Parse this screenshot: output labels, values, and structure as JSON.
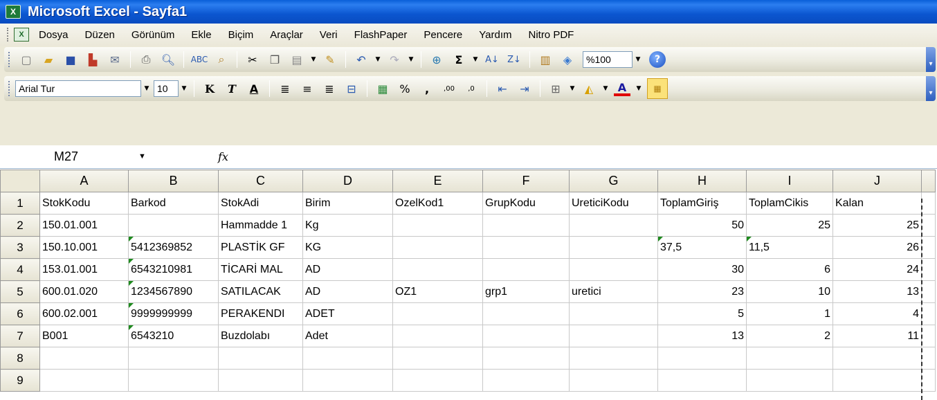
{
  "window": {
    "title": "Microsoft Excel - Sayfa1"
  },
  "menu": {
    "items": [
      "Dosya",
      "Düzen",
      "Görünüm",
      "Ekle",
      "Biçim",
      "Araçlar",
      "Veri",
      "FlashPaper",
      "Pencere",
      "Yardım",
      "Nitro PDF"
    ]
  },
  "toolbar": {
    "zoom": "%100"
  },
  "format_toolbar": {
    "font": "Arial Tur",
    "size": "10"
  },
  "formula_bar": {
    "name_box": "M27",
    "fx_label": "fx",
    "formula": ""
  },
  "sheet": {
    "columns": [
      "A",
      "B",
      "C",
      "D",
      "E",
      "F",
      "G",
      "H",
      "I",
      "J"
    ],
    "rows": [
      {
        "num": "1",
        "cells": [
          "StokKodu",
          "Barkod",
          "StokAdi",
          "Birim",
          "OzelKod1",
          "GrupKodu",
          "UreticiKodu",
          "ToplamGiriş",
          "ToplamCikis",
          "Kalan"
        ]
      },
      {
        "num": "2",
        "cells": [
          "150.01.001",
          "",
          "Hammadde 1",
          "Kg",
          "",
          "",
          "",
          "50",
          "25",
          "25"
        ]
      },
      {
        "num": "3",
        "cells": [
          "150.10.001",
          "5412369852",
          "PLASTİK GF",
          "KG",
          "",
          "",
          "",
          "37,5",
          "11,5",
          "26"
        ]
      },
      {
        "num": "4",
        "cells": [
          "153.01.001",
          "6543210981",
          "TİCARİ MAL",
          "AD",
          "",
          "",
          "",
          "30",
          "6",
          "24"
        ]
      },
      {
        "num": "5",
        "cells": [
          "600.01.020",
          "1234567890",
          "SATILACAK",
          "AD",
          "OZ1",
          "grp1",
          "uretici",
          "23",
          "10",
          "13"
        ]
      },
      {
        "num": "6",
        "cells": [
          "600.02.001",
          "9999999999",
          "PERAKENDI",
          "ADET",
          "",
          "",
          "",
          "5",
          "1",
          "4"
        ]
      },
      {
        "num": "7",
        "cells": [
          "B001",
          "6543210",
          "Buzdolabı",
          "Adet",
          "",
          "",
          "",
          "13",
          "2",
          "11"
        ]
      },
      {
        "num": "8",
        "cells": [
          "",
          "",
          "",
          "",
          "",
          "",
          "",
          "",
          "",
          ""
        ]
      },
      {
        "num": "9",
        "cells": [
          "",
          "",
          "",
          "",
          "",
          "",
          "",
          "",
          "",
          ""
        ]
      }
    ]
  }
}
